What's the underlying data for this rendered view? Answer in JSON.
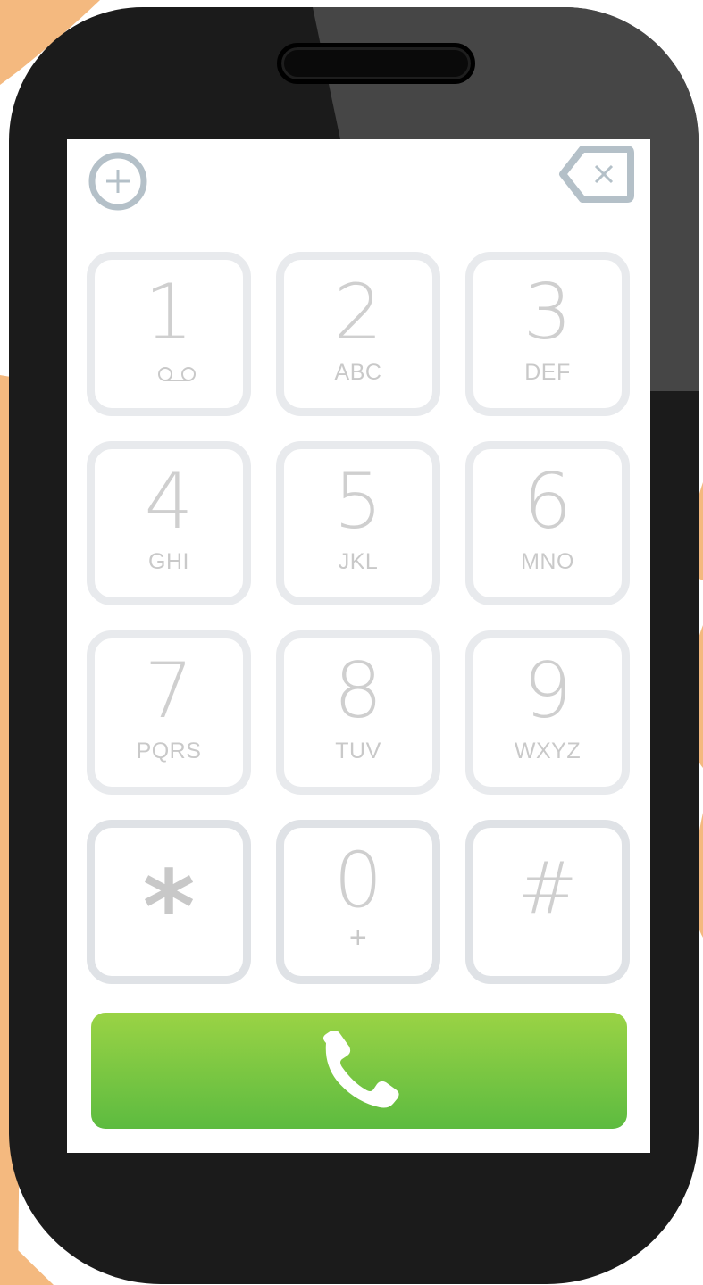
{
  "colors": {
    "hand": "#f4b97f",
    "phone_body": "#1b1b1b",
    "phone_sheen": "#4d4d4d",
    "screen": "#ffffff",
    "key_border": "#e8eaed",
    "key_text": "#cfcfcf",
    "icon_gray": "#b4c0c8",
    "call_green_top": "#9ad345",
    "call_green_bottom": "#5dbb40"
  },
  "toolbar": {
    "add_icon": "plus-circle-icon",
    "backspace_icon": "backspace-icon"
  },
  "keypad": {
    "keys": [
      {
        "digit": "1",
        "letters": "",
        "icon": "voicemail-icon"
      },
      {
        "digit": "2",
        "letters": "ABC"
      },
      {
        "digit": "3",
        "letters": "DEF"
      },
      {
        "digit": "4",
        "letters": "GHI"
      },
      {
        "digit": "5",
        "letters": "JKL"
      },
      {
        "digit": "6",
        "letters": "MNO"
      },
      {
        "digit": "7",
        "letters": "PQRS"
      },
      {
        "digit": "8",
        "letters": "TUV"
      },
      {
        "digit": "9",
        "letters": "WXYZ"
      },
      {
        "digit": "*",
        "letters": ""
      },
      {
        "digit": "0",
        "letters": "+"
      },
      {
        "digit": "#",
        "letters": ""
      }
    ]
  },
  "call_button": {
    "icon": "phone-icon"
  }
}
